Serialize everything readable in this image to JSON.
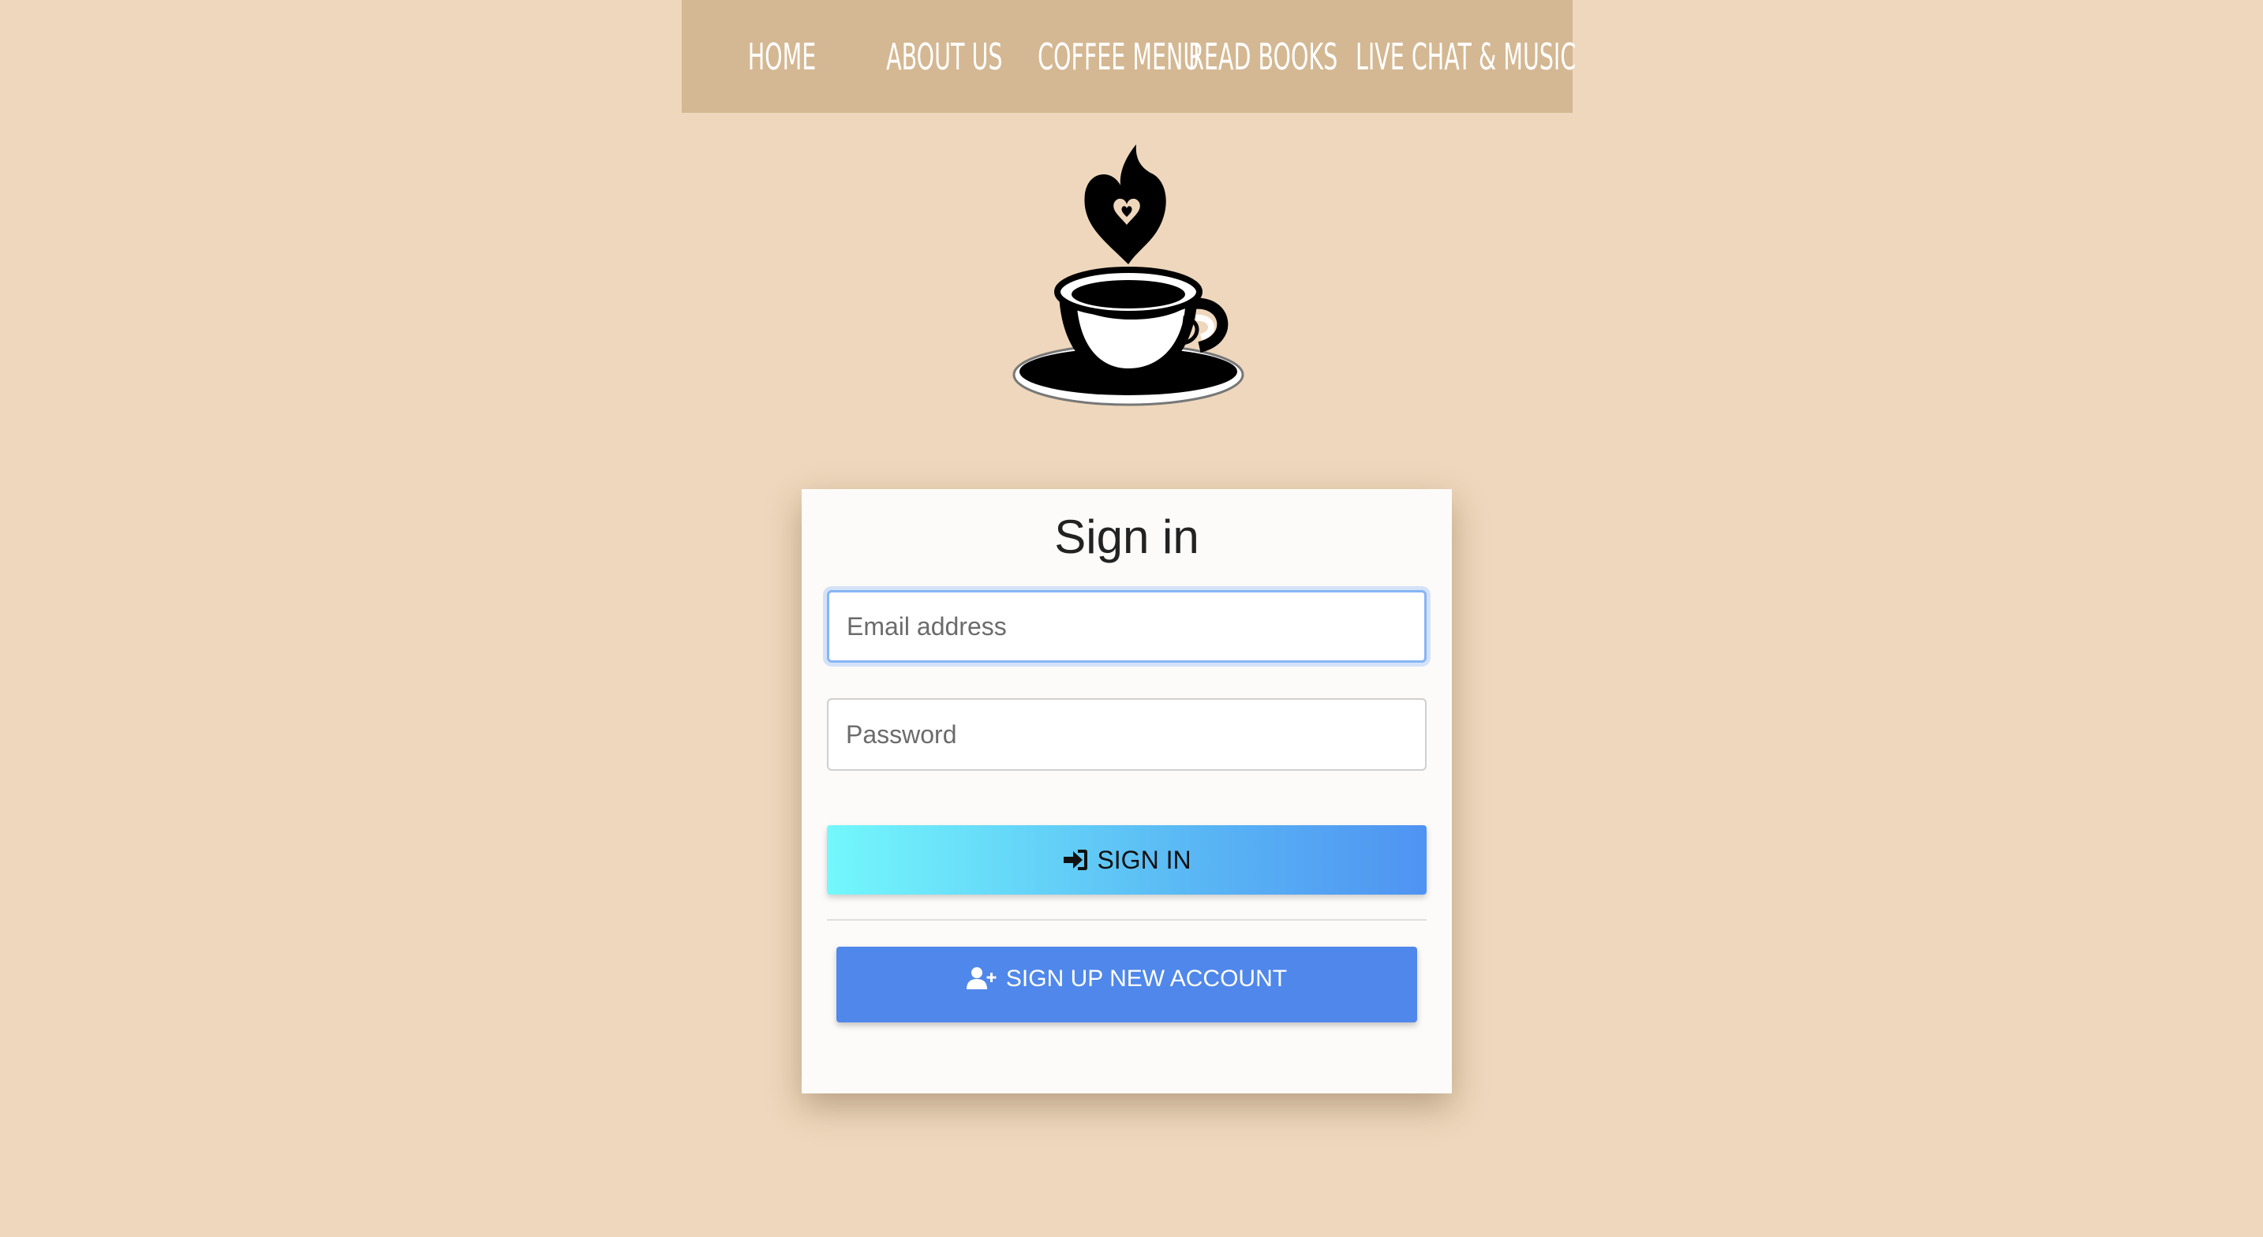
{
  "nav": {
    "items": [
      {
        "label": "HOME"
      },
      {
        "label": "ABOUT US"
      },
      {
        "label": "COFFEE MENU"
      },
      {
        "label": "READ BOOKS"
      },
      {
        "label": "LIVE CHAT & MUSIC"
      }
    ]
  },
  "logo": {
    "icon": "coffee-cup-heart-steam-logo"
  },
  "signin_form": {
    "title": "Sign in",
    "email_placeholder": "Email address",
    "password_placeholder": "Password",
    "signin_label": "SIGN IN",
    "signup_label": "SIGN UP NEW ACCOUNT",
    "signin_icon": "sign-in-icon",
    "signup_icon": "user-plus-icon"
  },
  "colors": {
    "background": "#eed7bc",
    "navbar": "#d4b893",
    "signup_button": "#5087ea",
    "signin_gradient_start": "#73f8fc",
    "signin_gradient_end": "#4f93f2"
  }
}
